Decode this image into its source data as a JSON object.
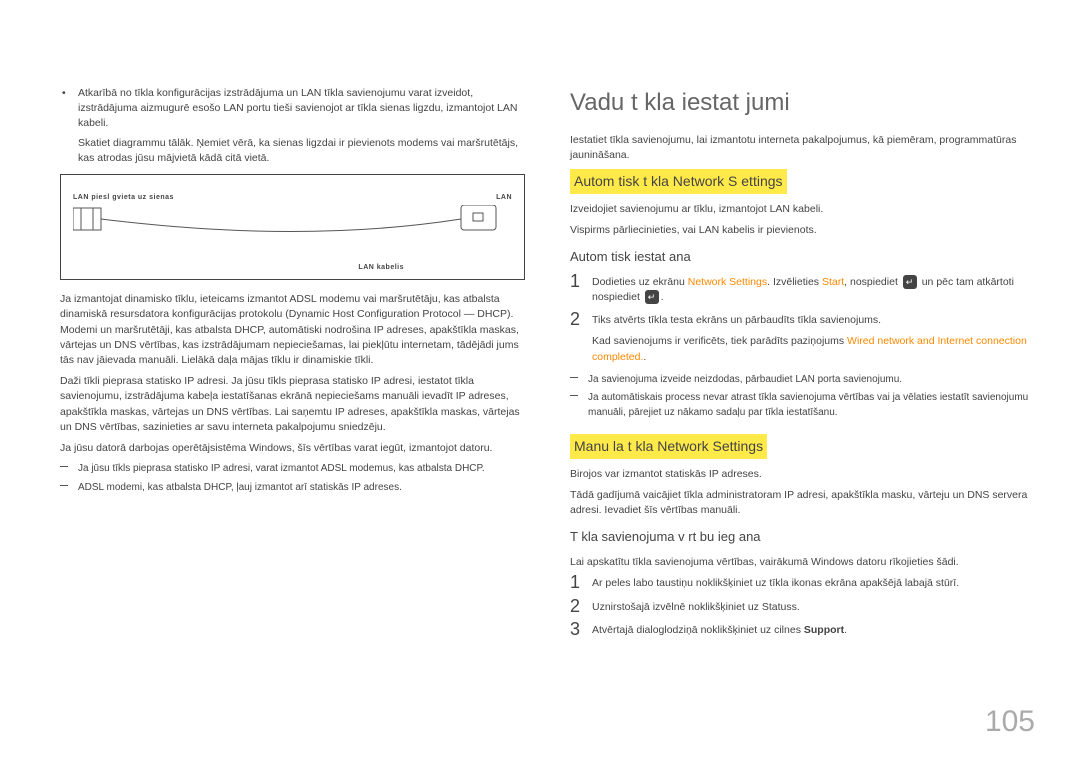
{
  "left": {
    "bullet1": "Atkarībā no tīkla konfigurācijas izstrādājuma un LAN tīkla savienojumu varat izveidot, izstrādājuma aizmugurē esošo LAN portu tieši savienojot ar tīkla sienas ligzdu, izmantojot LAN kabeli.",
    "bullet1b": "Skatiet diagrammu tālāk. Ņemiet vērā, ka sienas ligzdai ir pievienots modems vai maršrutētājs, kas atrodas jūsu mājvietā kādā citā vietā.",
    "diag": {
      "tl": "LAN piesl gvieta uz sienas",
      "tr": "LAN",
      "br": "LAN kabelis"
    },
    "p1": "Ja izmantojat dinamisko tīklu, ieteicams izmantot ADSL modemu vai maršrutētāju, kas atbalsta dinamiskā resursdatora konfigurācijas protokolu (Dynamic Host Configuration Protocol — DHCP). Modemi un maršrutētāji, kas atbalsta DHCP, automātiski nodrošina IP adreses, apakštīkla maskas, vārtejas un DNS vērtības, kas izstrādājumam nepieciešamas, lai piekļūtu internetam, tādējādi jums tās nav jāievada manuāli. Lielākā daļa mājas tīklu ir dinamiskie tīkli.",
    "p2": "Daži tīkli pieprasa statisko IP adresi. Ja jūsu tīkls pieprasa statisko IP adresi, iestatot tīkla savienojumu, izstrādājuma kabeļa iestatīšanas ekrānā nepieciešams manuāli ievadīt IP adreses, apakštīkla maskas, vārtejas un DNS vērtības. Lai saņemtu IP adreses, apakštīkla maskas, vārtejas un DNS vērtības, sazinieties ar savu interneta pakalpojumu sniedzēju.",
    "p3": "Ja jūsu datorā darbojas operētājsistēma Windows, šīs vērtības varat iegūt, izmantojot datoru.",
    "sub1": "Ja jūsu tīkls pieprasa statisko IP adresi, varat izmantot ADSL modemus, kas atbalsta DHCP.",
    "sub2": "ADSL modemi, kas atbalsta DHCP, ļauj izmantot arī statiskās IP adreses."
  },
  "right": {
    "h1": "Vadu t kla iestat jumi",
    "intro": "Iestatiet tīkla savienojumu, lai izmantotu interneta pakalpojumus, kā piemēram, programmatūras jaunināšana.",
    "autoH2": "Autom tisk  t kla Network S ettings",
    "autoP1": "Izveidojiet savienojumu ar tīklu, izmantojot LAN kabeli.",
    "autoP2": "Vispirms pārliecinieties, vai LAN kabelis ir pievienots.",
    "autoH3": "Autom tisk  iestat  ana",
    "step1a": "Dodieties uz ekrānu ",
    "step1b": "Network Settings",
    "step1c": ". Izvēlieties ",
    "step1d": "Start",
    "step1e": ", nospiediet",
    "step1f": " un pēc tam atkārtoti nospiediet ",
    "step2": "Tiks atvērts tīkla testa ekrāns un pārbaudīts tīkla savienojums.",
    "step2note": "Kad savienojums ir verificēts, tiek parādīts paziņojums ",
    "wiredMsg": "Wired network and Internet connection completed.",
    "autoSub1": "Ja savienojuma izveide neizdodas, pārbaudiet LAN porta savienojumu.",
    "autoSub2": "Ja automātiskais process nevar atrast tīkla savienojuma vērtības vai ja vēlaties iestatīt savienojumu manuāli, pārejiet uz nākamo sadaļu par tīkla iestatīšanu.",
    "manH2": "Manu la t kla Network Settings",
    "manP1": "Birojos var izmantot statiskās IP adreses.",
    "manP2": "Tādā gadījumā vaicājiet tīkla administratoram IP adresi, apakštīkla masku, vārteju un DNS servera adresi. Ievadiet šīs vērtības manuāli.",
    "manH3": "T kla savienojuma v rt bu ieg  ana",
    "manP3": "Lai apskatītu tīkla savienojuma vērtības, vairākumā Windows datoru rīkojieties šādi.",
    "mstep1": "Ar peles labo taustiņu noklikšķiniet uz tīkla ikonas ekrāna apakšējā labajā stūrī.",
    "mstep2": "Uznirstošajā izvēlnē noklikšķiniet uz Statuss.",
    "mstep3a": "Atvērtajā dialoglodziņā noklikšķiniet uz cilnes ",
    "mstep3b": "Support",
    "mstep3c": "."
  },
  "pagenum": "105"
}
